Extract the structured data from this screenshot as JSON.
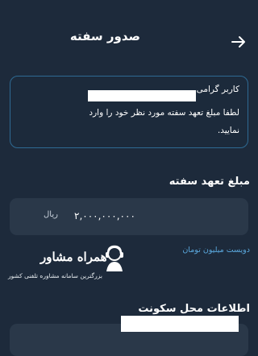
{
  "header": {
    "title": "صدور سفته",
    "back_icon": "arrow-right-icon"
  },
  "info": {
    "line1": "کاربر گرامی",
    "line2": "لطفا مبلغ تعهد سفته مورد نظر خود را وارد",
    "line3": "نمایید."
  },
  "amount": {
    "section_title": "مبلغ تعهد سفته",
    "value": "۲,۰۰۰,۰۰۰,۰۰۰",
    "unit": "ریال",
    "in_words": "دویست میلیون تومان"
  },
  "watermark": {
    "title": "همراه مشاور",
    "tagline": "بزرگترین سامانه مشاوره تلفنی کشور",
    "logo_icon": "headset-person-icon"
  },
  "residence": {
    "section_title": "اطلاعات محل سکونت"
  },
  "colors": {
    "background": "#1d2a3b",
    "field": "#2a3849",
    "card_border": "#2e6a93",
    "accent_text": "#5aa8dd"
  }
}
